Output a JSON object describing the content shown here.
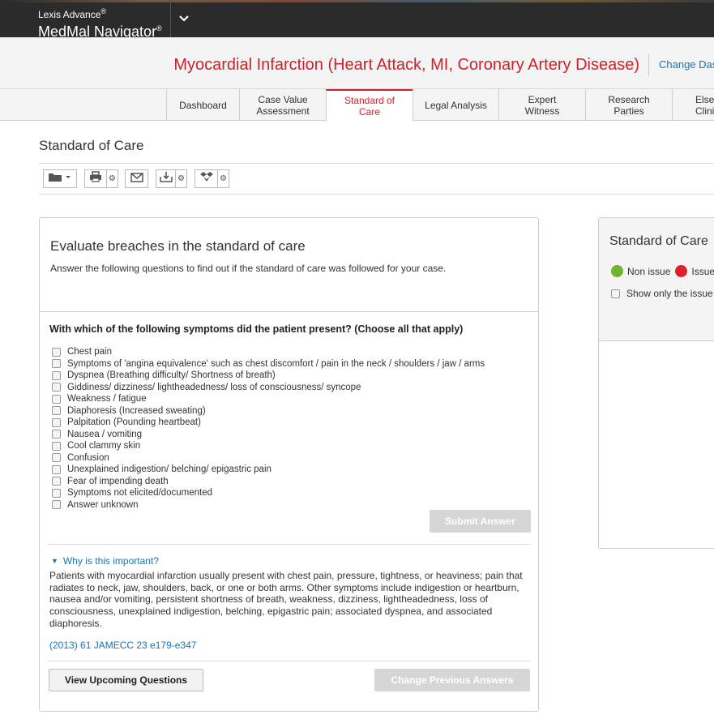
{
  "brand": {
    "small": "Lexis Advance",
    "small_mark": "®",
    "big": "MedMal Navigator",
    "big_mark": "®",
    "menu_icon": "chevron-down-icon"
  },
  "header": {
    "title": "Myocardial Infarction (Heart Attack, MI, Coronary Artery Disease)",
    "change_link": "Change Das"
  },
  "tabs": [
    {
      "line1": "Dashboard",
      "line2": ""
    },
    {
      "line1": "Case Value",
      "line2": "Assessment"
    },
    {
      "line1": "Standard of",
      "line2": "Care"
    },
    {
      "line1": "Legal Analysis",
      "line2": ""
    },
    {
      "line1": "Expert",
      "line2": "Witness"
    },
    {
      "line1": "Research",
      "line2": "Parties"
    },
    {
      "line1": "Elsev",
      "line2": "Clinic"
    }
  ],
  "section_title": "Standard of Care",
  "toolbar": {
    "icons": [
      "folder-icon",
      "print-icon",
      "email-icon",
      "download-icon",
      "dropbox-icon"
    ]
  },
  "panel": {
    "title": "Evaluate breaches in the standard of care",
    "subtitle": "Answer the following questions to find out if the standard of care was followed for your case.",
    "question": "With which of the following symptoms did the patient present? (Choose all that apply)",
    "options": [
      "Chest pain",
      "Symptoms of 'angina equivalence' such as chest discomfort / pain in the neck / shoulders / jaw / arms",
      "Dyspnea (Breathing difficulty/ Shortness of breath)",
      "Giddiness/ dizziness/ lightheadedness/ loss of consciousness/ syncope",
      "Weakness / fatigue",
      "Diaphoresis (Increased sweating)",
      "Palpitation (Pounding heartbeat)",
      "Nausea / vomiting",
      "Cool clammy skin",
      "Confusion",
      "Unexplained indigestion/ belching/ epigastric pain",
      "Fear of impending death",
      "Symptoms not elicited/documented",
      "Answer unknown"
    ],
    "submit_label": "Submit Answer",
    "why_label": "Why is this important?",
    "why_text": "Patients with myocardial infarction usually present with chest pain, pressure, tightness, or heaviness; pain that radiates to neck, jaw, shoulders, back, or one or both arms. Other symptoms include indigestion or heartburn, nausea and/or vomiting, persistent shortness of breath, weakness, dizziness, lightheadedness, loss of consciousness, unexplained indigestion, belching, epigastric pain; associated dyspnea, and associated diaphoresis.",
    "reference": "(2013) 61 JAMECC 23 e179-e347",
    "view_upcoming_label": "View Upcoming Questions",
    "change_previous_label": "Change Previous Answers"
  },
  "side": {
    "title": "Standard of Care",
    "non_issue_label": "Non issue",
    "issue_label": "Issue",
    "non_issue_color": "#6cb52d",
    "issue_color": "#e0202c",
    "show_only_label": "Show only the issue"
  }
}
